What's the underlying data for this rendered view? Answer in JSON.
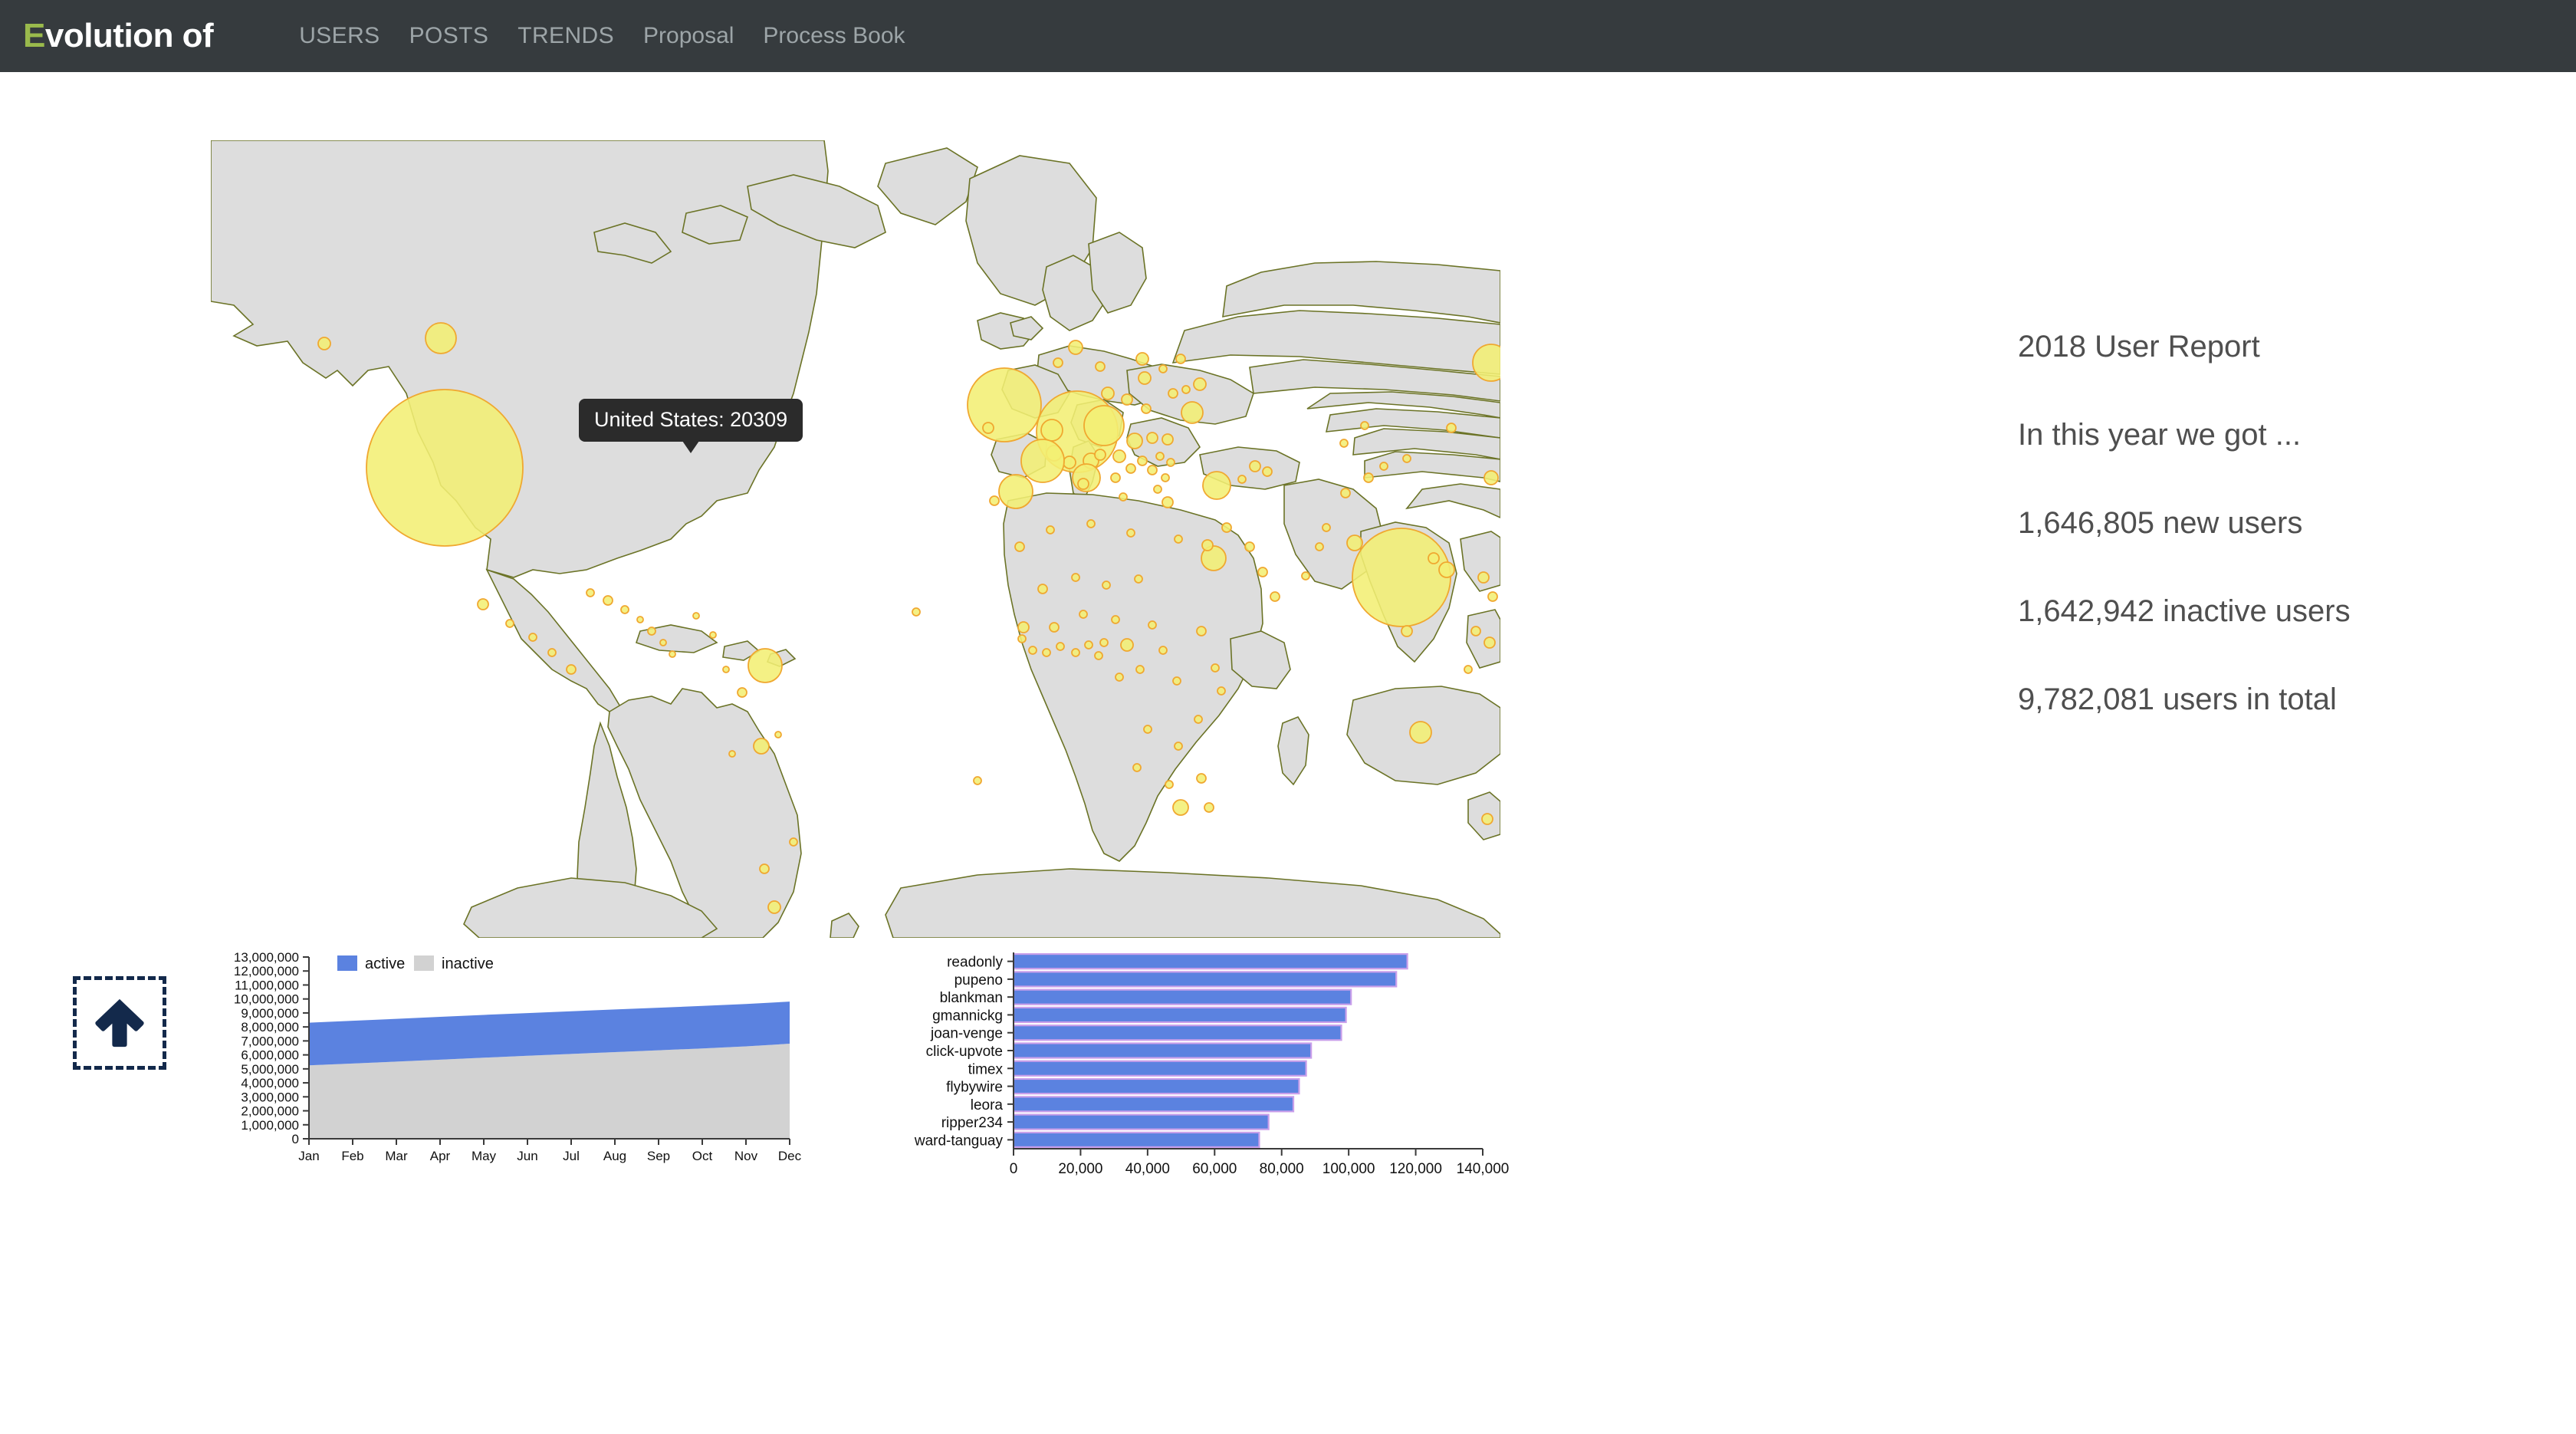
{
  "navbar": {
    "brand_initial": "E",
    "brand_rest": "volution of",
    "links": [
      {
        "label": "USERS",
        "style": "upper"
      },
      {
        "label": "POSTS",
        "style": "upper"
      },
      {
        "label": "TRENDS",
        "style": "upper"
      },
      {
        "label": "Proposal",
        "style": "normal"
      },
      {
        "label": "Process Book",
        "style": "normal"
      }
    ],
    "bg_color": "#363b3e",
    "brand_accent_color": "#9aba4c",
    "link_color": "#9da5a8"
  },
  "map": {
    "tooltip": {
      "country": "United States",
      "value": "20309",
      "text": "United States: 20309"
    },
    "land_fill": "#dddddd",
    "land_stroke": "#6b7326",
    "bubble_fill": "#f2ef74",
    "bubble_stroke": "#f0a830"
  },
  "report": {
    "title": "2018 User Report",
    "lines": [
      "In this year we got ...",
      "1,646,805 new users",
      "1,642,942 inactive users",
      "9,782,081 users in total"
    ],
    "new_users": "1,646,805",
    "inactive_users": "1,642,942",
    "total_users": "9,782,081",
    "year": "2018"
  },
  "scroll_top_button": {
    "icon": "arrow-up-icon",
    "color": "#13294b"
  },
  "chart_data": [
    {
      "type": "area",
      "id": "users-over-year",
      "title": "",
      "xlabel": "",
      "ylabel": "",
      "stacked": true,
      "grid": false,
      "legend_position": "top-left",
      "categories": [
        "Jan",
        "Feb",
        "Mar",
        "Apr",
        "May",
        "Jun",
        "Jul",
        "Aug",
        "Sep",
        "Oct",
        "Nov",
        "Dec"
      ],
      "ytick_labels": [
        "0",
        "1,000,000",
        "2,000,000",
        "3,000,000",
        "4,000,000",
        "5,000,000",
        "6,000,000",
        "7,000,000",
        "8,000,000",
        "9,000,000",
        "10,000,000",
        "11,000,000",
        "12,000,000",
        "13,000,000"
      ],
      "ylim": [
        0,
        13000000
      ],
      "series": [
        {
          "name": "inactive",
          "color": "#d2d2d2",
          "values": [
            5250000,
            5380000,
            5520000,
            5660000,
            5800000,
            5940000,
            6070000,
            6200000,
            6330000,
            6460000,
            6610000,
            6800000
          ]
        },
        {
          "name": "active",
          "color": "#5b82e0",
          "values": [
            3050000,
            3060000,
            3060000,
            3060000,
            3060000,
            3050000,
            3050000,
            3050000,
            3040000,
            3040000,
            3030000,
            3010000
          ]
        }
      ],
      "legend": [
        "active",
        "inactive"
      ]
    },
    {
      "type": "bar",
      "id": "top-users",
      "orientation": "horizontal",
      "title": "",
      "xlabel": "",
      "ylabel": "",
      "grid": false,
      "xlim": [
        0,
        140000
      ],
      "xtick_labels": [
        "0",
        "20,000",
        "40,000",
        "60,000",
        "80,000",
        "100,000",
        "120,000",
        "140,000"
      ],
      "xticks": [
        0,
        20000,
        40000,
        60000,
        80000,
        100000,
        120000,
        140000
      ],
      "categories": [
        "readonly",
        "pupeno",
        "blankman",
        "gmannickg",
        "joan-venge",
        "click-upvote",
        "timex",
        "flybywire",
        "leora",
        "ripper234",
        "ward-tanguay"
      ],
      "values": [
        117500,
        114200,
        100700,
        99200,
        97800,
        88800,
        87300,
        85200,
        83500,
        76100,
        73300
      ],
      "bar_color": "#5b82e0",
      "bar_stroke": "#c99fea"
    }
  ]
}
